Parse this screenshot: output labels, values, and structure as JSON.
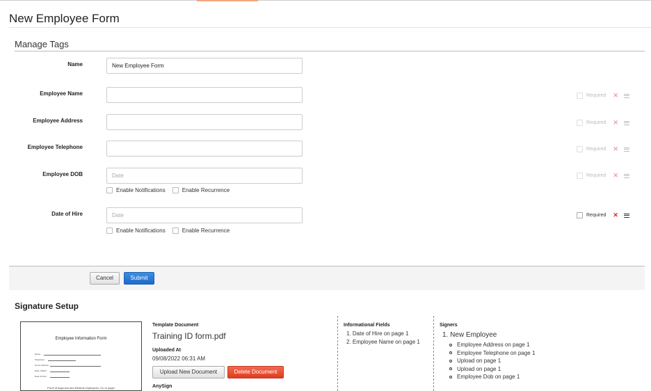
{
  "page": {
    "title": "New Employee Form"
  },
  "manage_tags": {
    "title": "Manage Tags",
    "fields": [
      {
        "label": "Name",
        "value": "New Employee Form",
        "placeholder": ""
      },
      {
        "label": "Employee Name",
        "value": "",
        "placeholder": "",
        "required_label": "Required"
      },
      {
        "label": "Employee Address",
        "value": "",
        "placeholder": "",
        "required_label": "Required"
      },
      {
        "label": "Employee Telephone",
        "value": "",
        "placeholder": "",
        "required_label": "Required"
      },
      {
        "label": "Employee DOB",
        "value": "",
        "placeholder": "Date",
        "required_label": "Required",
        "options": [
          "Enable Notifications",
          "Enable Recurrence"
        ]
      },
      {
        "label": "Date of Hire",
        "value": "",
        "placeholder": "Date",
        "required_label": "Required",
        "options": [
          "Enable Notifications",
          "Enable Recurrence"
        ]
      }
    ],
    "remove_icon": "close-x-icon",
    "menu_icon": "list-menu-icon"
  },
  "actions": {
    "cancel_label": "Cancel",
    "submit_label": "Submit"
  },
  "signature_setup": {
    "title": "Signature Setup",
    "thumbnail": {
      "title": "Employee Information Form",
      "fields": [
        "Name:",
        "Telephone:",
        "Home Address:",
        "Date of Birth:",
        "Date Of Hire:"
      ],
      "footer": "Proof of Approval and Medical employees: Go to page!"
    },
    "template_document_label": "Template Document",
    "file_name": "Training ID form.pdf",
    "uploaded_at_label": "Uploaded At",
    "uploaded_at": "09/08/2022 06:31 AM",
    "upload_button": "Upload New Document",
    "delete_button": "Delete Document",
    "anysign_label": "AnySign",
    "informational_fields_label": "Informational Fields",
    "informational_fields": [
      "1. Date of Hire on page 1",
      "2. Employee Name on page 1"
    ],
    "signers_label": "Signers",
    "signer_name": "1. New Employee",
    "signer_fields": [
      "Employee Address on page 1",
      "Employee Telephone on page 1",
      "Upload on page 1",
      "Upload on page 1",
      "Employee Dob on page 1"
    ]
  },
  "colors": {
    "submit": "#1d6ac9",
    "delete": "#df3c1f",
    "remove_active": "#d9262b"
  }
}
